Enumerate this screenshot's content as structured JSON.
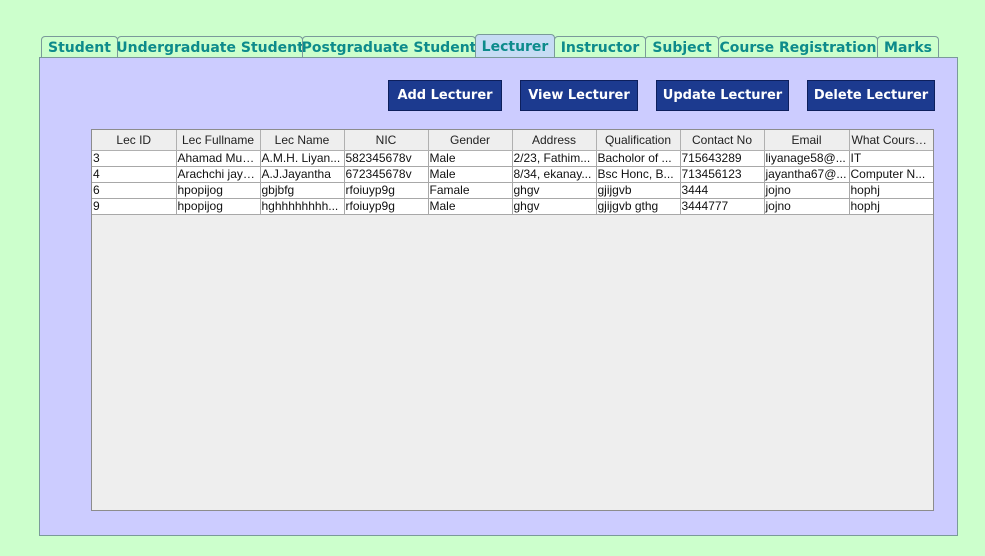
{
  "tabs": [
    {
      "label": "Student",
      "active": false
    },
    {
      "label": "Undergraduate Student",
      "active": false
    },
    {
      "label": "Postgraduate Student",
      "active": false
    },
    {
      "label": "Lecturer",
      "active": true
    },
    {
      "label": "Instructor",
      "active": false
    },
    {
      "label": "Subject",
      "active": false
    },
    {
      "label": "Course Registration",
      "active": false
    },
    {
      "label": "Marks",
      "active": false
    }
  ],
  "toolbar": {
    "add_label": "Add Lecturer",
    "view_label": "View Lecturer",
    "update_label": "Update Lecturer",
    "delete_label": "Delete Lecturer"
  },
  "table": {
    "columns": [
      "Lec ID",
      "Lec Fullname",
      "Lec Name",
      "NIC",
      "Gender",
      "Address",
      "Qualification",
      "Contact No",
      "Email",
      "What Course..."
    ],
    "rows": [
      [
        "3",
        "Ahamad Mud...",
        "A.M.H. Liyan...",
        "582345678v",
        "Male",
        "2/23, Fathim...",
        "Bacholor of ...",
        "715643289",
        "liyanage58@...",
        "IT"
      ],
      [
        "4",
        "Arachchi jaya...",
        "A.J.Jayantha",
        "672345678v",
        "Male",
        "8/34, ekanay...",
        "Bsc Honc, B...",
        "713456123",
        "jayantha67@...",
        "Computer N..."
      ],
      [
        "6",
        "hpopijog",
        "gbjbfg",
        "rfoiuyp9g",
        "Famale",
        "ghgv",
        "gjijgvb",
        "3444",
        "jojno",
        "hophj"
      ],
      [
        "9",
        "hpopijog",
        "hghhhhhhhh...",
        "rfoiuyp9g",
        "Male",
        "ghgv",
        "gjijgvb gthg",
        "3444777",
        "jojno",
        "hophj"
      ]
    ]
  },
  "colors": {
    "background": "#ccffcc",
    "panel": "#ccccff",
    "tab_text": "#0d8b8b",
    "active_tab": "#c6dcf4",
    "button": "#1c3a8f"
  }
}
